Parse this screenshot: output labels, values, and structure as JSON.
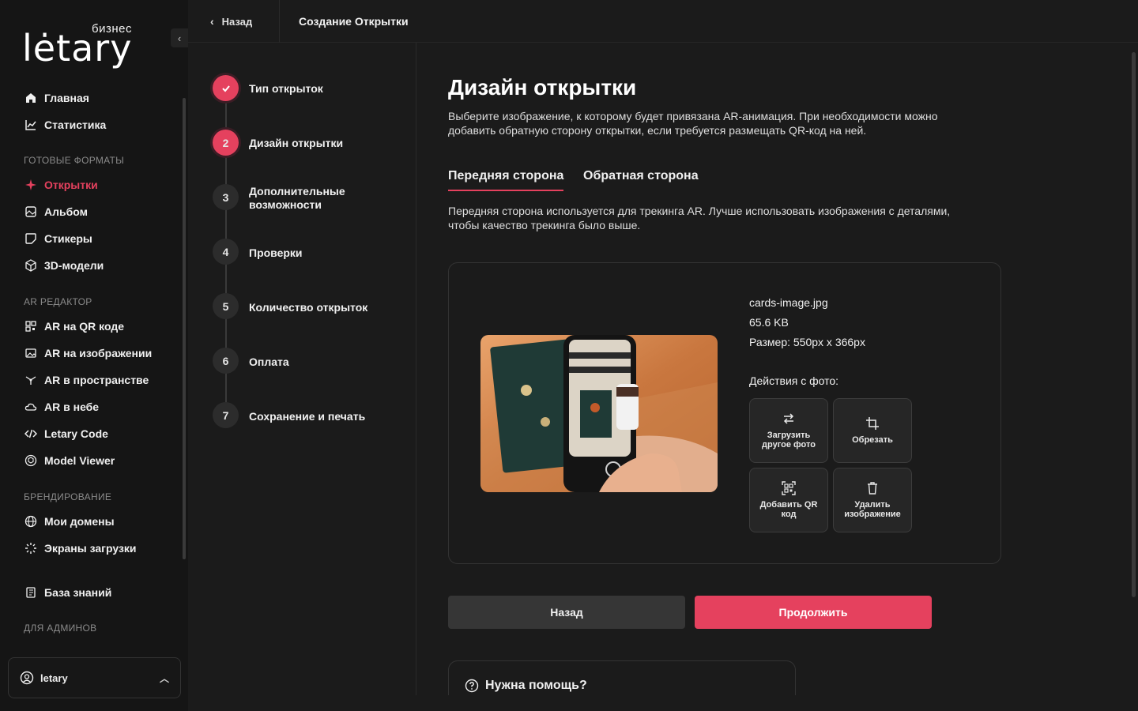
{
  "brand": {
    "logo_text": "lėtary",
    "logo_badge": "бизнес"
  },
  "sidebar": {
    "top_items": [
      {
        "label": "Главная",
        "icon": "home-icon"
      },
      {
        "label": "Статистика",
        "icon": "chart-icon"
      }
    ],
    "sections": {
      "ready_formats": "ГОТОВЫЕ ФОРМАТЫ",
      "ar_editor": "AR РЕДАКТОР",
      "branding": "БРЕНДИРОВАНИЕ",
      "for_admins": "ДЛЯ АДМИНОВ"
    },
    "formats": [
      {
        "label": "Открытки",
        "icon": "sparkle-icon"
      },
      {
        "label": "Альбом",
        "icon": "album-icon"
      },
      {
        "label": "Стикеры",
        "icon": "sticker-icon"
      },
      {
        "label": "3D-модели",
        "icon": "cube-icon"
      }
    ],
    "ar_items": [
      {
        "label": "AR на QR коде",
        "icon": "qr-icon"
      },
      {
        "label": "AR на изображении",
        "icon": "image-icon"
      },
      {
        "label": "AR в пространстве",
        "icon": "space-icon"
      },
      {
        "label": "AR в небе",
        "icon": "cloud-icon"
      },
      {
        "label": "Letary Code",
        "icon": "code-icon"
      },
      {
        "label": "Model Viewer",
        "icon": "model-viewer-icon"
      }
    ],
    "branding_items": [
      {
        "label": "Мои домены",
        "icon": "globe-icon"
      },
      {
        "label": "Экраны загрузки",
        "icon": "loader-icon"
      }
    ],
    "knowledge_base": "База знаний",
    "user": "letary",
    "active_color": "#e5415e"
  },
  "header": {
    "back_label": "Назад",
    "title": "Создание Открытки"
  },
  "steps": [
    {
      "number": "✓",
      "label": "Тип открыток",
      "state": "done"
    },
    {
      "number": "2",
      "label": "Дизайн открытки",
      "state": "current"
    },
    {
      "number": "3",
      "label": "Дополнительные возможности",
      "state": "todo"
    },
    {
      "number": "4",
      "label": "Проверки",
      "state": "todo"
    },
    {
      "number": "5",
      "label": "Количество открыток",
      "state": "todo"
    },
    {
      "number": "6",
      "label": "Оплата",
      "state": "todo"
    },
    {
      "number": "7",
      "label": "Сохранение и печать",
      "state": "todo"
    }
  ],
  "main": {
    "title": "Дизайн открытки",
    "description": "Выберите изображение, к которому будет привязана AR-анимация. При необходимости можно добавить обратную сторону открытки, если требуется размещать QR-код на ней.",
    "tabs": [
      {
        "label": "Передняя сторона",
        "active": true
      },
      {
        "label": "Обратная сторона",
        "active": false
      }
    ],
    "tab_description": "Передняя сторона используется для трекинга AR. Лучше использовать изображения с деталями, чтобы качество трекинга было выше.",
    "file": {
      "name": "cards-image.jpg",
      "size": "65.6 KB",
      "dimensions": "Размер: 550px x 366px"
    },
    "actions_title": "Действия с фото:",
    "actions": [
      {
        "label": "Загрузить другое фото",
        "icon": "swap-icon"
      },
      {
        "label": "Обрезать",
        "icon": "crop-icon"
      },
      {
        "label": "Добавить QR код",
        "icon": "qr-scan-icon"
      },
      {
        "label": "Удалить изображение",
        "icon": "trash-icon"
      }
    ],
    "back_button": "Назад",
    "continue_button": "Продолжить",
    "help_title": "Нужна помощь?"
  }
}
